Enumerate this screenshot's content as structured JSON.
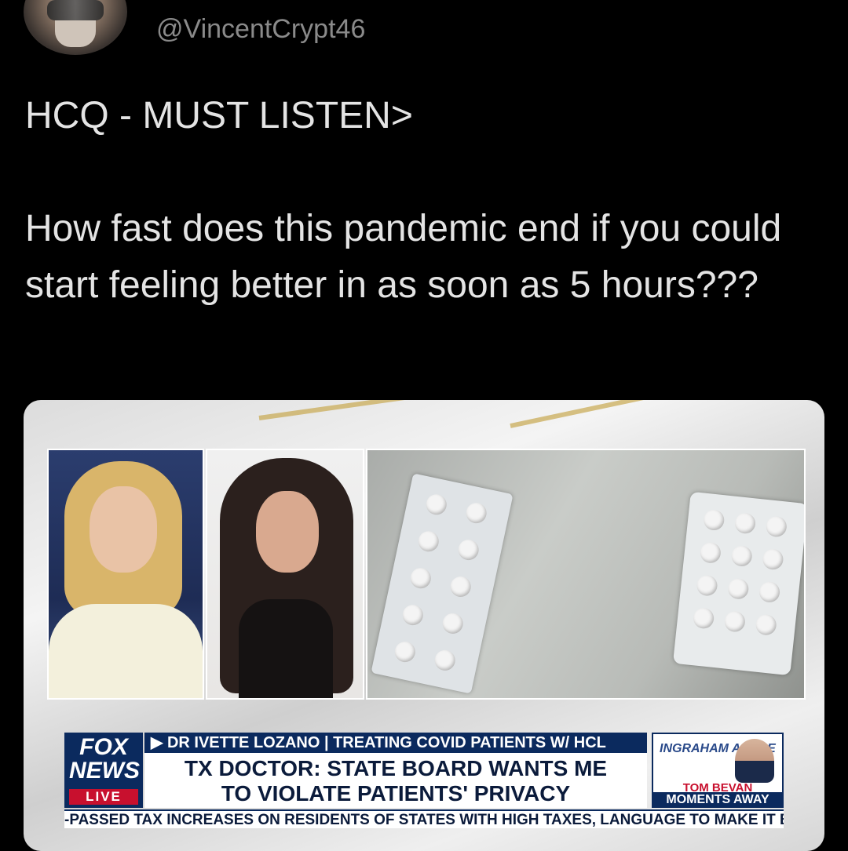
{
  "tweet": {
    "handle": "@VincentCrypt46",
    "line1": "HCQ - MUST LISTEN>",
    "body": "How fast does this pandemic end if you could start feeling better in as soon as 5 hours???"
  },
  "broadcast": {
    "logo_line1": "FOX",
    "logo_line2": "NEWS",
    "live": "LIVE",
    "topbar": "▶ DR IVETTE LOZANO | TREATING COVID PATIENTS W/ HCL",
    "headline_line1": "TX DOCTOR: STATE BOARD WANTS ME",
    "headline_line2": "TO VIOLATE PATIENTS' PRIVACY",
    "show_logo": "INGRAHAM ANGLE",
    "upnext_name": "TOM BEVAN",
    "upnext_status": "MOMENTS AWAY",
    "ticker": "-PASSED TAX INCREASES ON RESIDENTS OF STATES WITH HIGH TAXES, LANGUAGE TO MAKE IT EASIER TO"
  }
}
